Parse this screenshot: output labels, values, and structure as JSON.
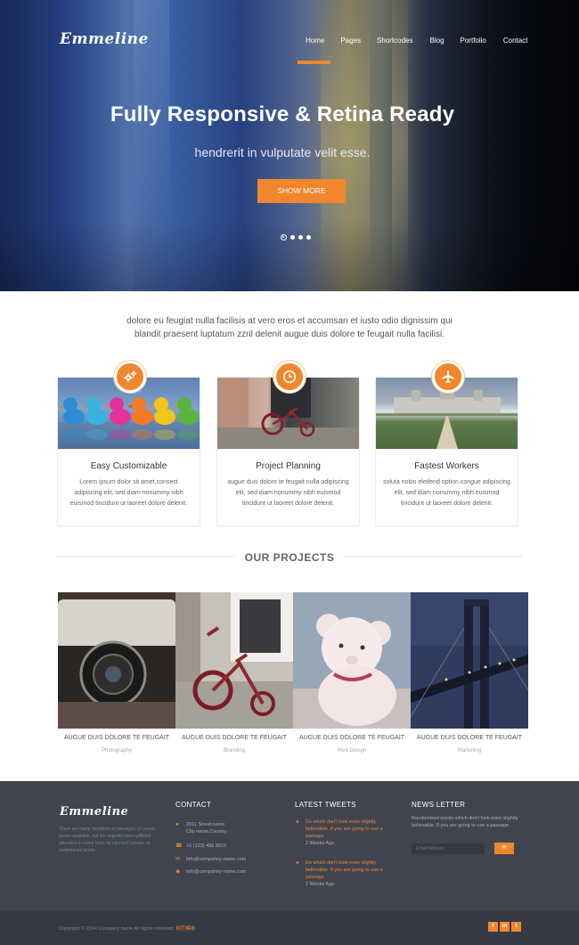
{
  "brand": {
    "name": "Emmeline",
    "accent_color": "#f0872c",
    "footer_bg": "#3f4450"
  },
  "nav": {
    "items": [
      "Home",
      "Pages",
      "Shortcodes",
      "Blog",
      "Portfolio",
      "Contact"
    ],
    "active": "Home"
  },
  "hero": {
    "title": "Fully Responsive & Retina Ready",
    "subtitle": "hendrerit in vulputate velit esse.",
    "button_label": "SHOW MORE",
    "slides": 4,
    "active_slide": 1
  },
  "intro": {
    "line1": "dolore eu feugiat nulla facilisis at vero eros et accumsan et iusto odio dignissim qui",
    "line2": "blandit praesent luptatum zzril delenit augue duis dolore te feugait nulla facilisi."
  },
  "features": [
    {
      "icon": "gear-icon",
      "title": "Easy Customizable",
      "text": "Lorem ipsum dolor sit amet,consect adipiscing elit, sed diam nonummy nibh euismod tincidunt ut laoreet dolore delenit."
    },
    {
      "icon": "clock-icon",
      "title": "Project Planning",
      "text": "augue duis dolore te feugait nulla adipiscing elit, sed diam nonummy nibh euismod tincidunt ut laoreet dolore delenit."
    },
    {
      "icon": "plane-icon",
      "title": "Fastest Workers",
      "text": "soluta nobis eleifend option congue adipiscing elit, sed diam nonummy nibh euismod tincidunt ut laoreet dolore delenit."
    }
  ],
  "projects": {
    "heading": "OUR PROJECTS",
    "items": [
      {
        "title": "AUGUE DUIS DOLORE TE FEUGAIT",
        "category": "Photography"
      },
      {
        "title": "AUGUE DUIS DOLORE TE FEUGAIT",
        "category": "Branding"
      },
      {
        "title": "AUGUE DUIS DOLORE TE FEUGAIT",
        "category": "Web Design"
      },
      {
        "title": "AUGUE DUIS DOLORE TE FEUGAIT",
        "category": "Marketing"
      }
    ]
  },
  "footer": {
    "about": "There are many variations of passages of Lorem Ipsum available, but the majority have suffered alteration in some form, by injected humour, or randomised words.",
    "contact": {
      "heading": "CONTACT",
      "address_line1": "2011 Street name,",
      "address_line2": "City name,Country",
      "phone": "+1 (123) 456 8910",
      "email": "info@compahny-name.com",
      "web": "info@compahny-name.com"
    },
    "tweets": {
      "heading": "LATEST TWEETS",
      "items": [
        {
          "text": "Do which don't look even slightly believable. If you are going to use a passage",
          "time": "2 Weeks Ago"
        },
        {
          "text": "Do which don't look even slightly believable. If you are going to use a passage",
          "time": "2 Weeks Ago"
        }
      ]
    },
    "newsletter": {
      "heading": "NEWS LETTER",
      "text": "Randomised words which don't look even slightly believable. If you are going to use a passage",
      "placeholder": "Email Address",
      "button_icon": "mail-icon"
    },
    "copyright": "Copyright © 2014 Company name All rights reserved.",
    "copyright_link": "网页模板",
    "social": [
      "f",
      "in",
      "t"
    ]
  }
}
